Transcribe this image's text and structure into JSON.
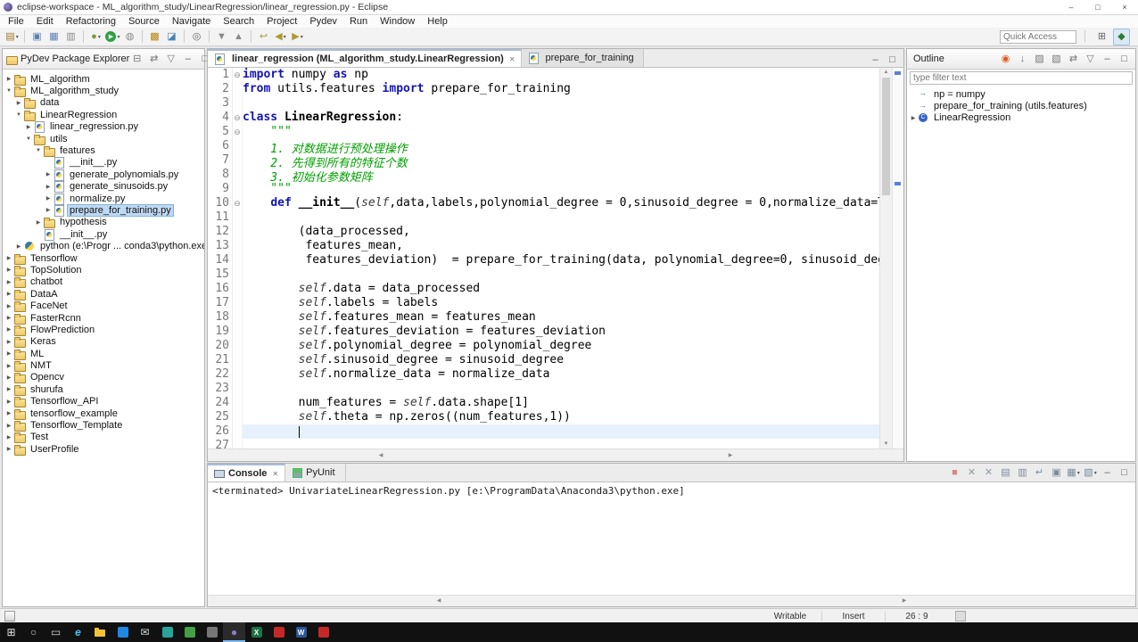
{
  "titlebar": {
    "title": "eclipse-workspace - ML_algorithm_study/LinearRegression/linear_regression.py - Eclipse",
    "controls": {
      "minimize": "–",
      "maximize": "□",
      "close": "×"
    }
  },
  "menubar": {
    "items": [
      "File",
      "Edit",
      "Refactoring",
      "Source",
      "Navigate",
      "Search",
      "Project",
      "Pydev",
      "Run",
      "Window",
      "Help"
    ]
  },
  "toolbar": {
    "quick_access_placeholder": "Quick Access",
    "items": [
      {
        "name": "new-wizard-button",
        "glyph": "▤",
        "color": "#a07828",
        "caret": true
      },
      "|",
      {
        "name": "save-button",
        "glyph": "▣",
        "color": "#5b7fb4"
      },
      {
        "name": "save-all-button",
        "glyph": "▦",
        "color": "#5b7fb4"
      },
      {
        "name": "print-button",
        "glyph": "▥",
        "color": "#888888"
      },
      "|",
      {
        "name": "debug-button",
        "glyph": "●",
        "color": "#7a9b3f",
        "caret": true
      },
      {
        "name": "run-button",
        "glyph": "▶",
        "color": "#2f9e44",
        "circle": true,
        "caret": true
      },
      {
        "name": "coverage-button",
        "glyph": "◍",
        "color": "#888888"
      },
      "|",
      {
        "name": "new-pydev-package-button",
        "glyph": "▩",
        "color": "#b8860b"
      },
      {
        "name": "new-pydev-module-button",
        "glyph": "◪",
        "color": "#4682b4"
      },
      "|",
      {
        "name": "search-button",
        "glyph": "◎",
        "color": "#666666"
      },
      "|",
      {
        "name": "next-annotation-button",
        "glyph": "▼",
        "color": "#888888"
      },
      {
        "name": "previous-annotation-button",
        "glyph": "▲",
        "color": "#888888"
      },
      "|",
      {
        "name": "last-edit-location-button",
        "glyph": "↩",
        "color": "#b09a30"
      },
      {
        "name": "back-button",
        "glyph": "◀",
        "color": "#b09a30",
        "caret": true
      },
      {
        "name": "forward-button",
        "glyph": "▶",
        "color": "#b09a30",
        "caret": true
      }
    ],
    "perspective_icons": [
      {
        "name": "open-perspective-button",
        "glyph": "⊞",
        "color": "#666666"
      },
      {
        "name": "pydev-perspective-button",
        "glyph": "◆",
        "color": "#2e7d32",
        "active": true
      }
    ]
  },
  "explorer": {
    "title": "PyDev Package Explorer",
    "header_icons": [
      {
        "name": "collapse-all-button",
        "glyph": "⊟",
        "color": "#777777"
      },
      {
        "name": "link-with-editor-button",
        "glyph": "⇄",
        "color": "#777777"
      },
      {
        "name": "view-menu-button",
        "glyph": "▽",
        "color": "#777777"
      },
      {
        "name": "minimize-view-button",
        "glyph": "–",
        "color": "#555555"
      },
      {
        "name": "maximize-view-button",
        "glyph": "□",
        "color": "#555555"
      }
    ],
    "items": [
      {
        "depth": 0,
        "arrow": ">",
        "icon": "project",
        "label": "ML_algorithm"
      },
      {
        "depth": 0,
        "arrow": "v",
        "icon": "project",
        "label": "ML_algorithm_study"
      },
      {
        "depth": 1,
        "arrow": ">",
        "icon": "folder",
        "label": "data"
      },
      {
        "depth": 1,
        "arrow": "v",
        "icon": "folder",
        "label": "LinearRegression"
      },
      {
        "depth": 2,
        "arrow": ">",
        "icon": "pyfile",
        "label": "linear_regression.py"
      },
      {
        "depth": 2,
        "arrow": "v",
        "icon": "package",
        "label": "utils"
      },
      {
        "depth": 3,
        "arrow": "v",
        "icon": "package",
        "label": "features"
      },
      {
        "depth": 4,
        "arrow": "",
        "icon": "pyfile",
        "label": "__init__.py"
      },
      {
        "depth": 4,
        "arrow": ">",
        "icon": "pyfile",
        "label": "generate_polynomials.py"
      },
      {
        "depth": 4,
        "arrow": ">",
        "icon": "pyfile",
        "label": "generate_sinusoids.py"
      },
      {
        "depth": 4,
        "arrow": ">",
        "icon": "pyfile",
        "label": "normalize.py"
      },
      {
        "depth": 4,
        "arrow": ">",
        "icon": "pyfile",
        "label": "prepare_for_training.py",
        "selected": true
      },
      {
        "depth": 3,
        "arrow": ">",
        "icon": "package",
        "label": "hypothesis"
      },
      {
        "depth": 3,
        "arrow": "",
        "icon": "pyfile",
        "label": "__init__.py"
      },
      {
        "depth": 1,
        "arrow": ">",
        "icon": "python",
        "label": "python (e:\\Progr ... conda3\\python.exe)"
      },
      {
        "depth": 0,
        "arrow": ">",
        "icon": "project",
        "label": "Tensorflow"
      },
      {
        "depth": 0,
        "arrow": ">",
        "icon": "project",
        "label": "TopSolution"
      },
      {
        "depth": 0,
        "arrow": ">",
        "icon": "project",
        "label": "chatbot"
      },
      {
        "depth": 0,
        "arrow": ">",
        "icon": "project",
        "label": "DataA"
      },
      {
        "depth": 0,
        "arrow": ">",
        "icon": "project",
        "label": "FaceNet"
      },
      {
        "depth": 0,
        "arrow": ">",
        "icon": "project",
        "label": "FasterRcnn"
      },
      {
        "depth": 0,
        "arrow": ">",
        "icon": "project",
        "label": "FlowPrediction"
      },
      {
        "depth": 0,
        "arrow": ">",
        "icon": "project",
        "label": "Keras"
      },
      {
        "depth": 0,
        "arrow": ">",
        "icon": "project",
        "label": "ML"
      },
      {
        "depth": 0,
        "arrow": ">",
        "icon": "project",
        "label": "NMT"
      },
      {
        "depth": 0,
        "arrow": ">",
        "icon": "project",
        "label": "Opencv"
      },
      {
        "depth": 0,
        "arrow": ">",
        "icon": "project",
        "label": "shurufa"
      },
      {
        "depth": 0,
        "arrow": ">",
        "icon": "project",
        "label": "Tensorflow_API"
      },
      {
        "depth": 0,
        "arrow": ">",
        "icon": "project",
        "label": "tensorflow_example"
      },
      {
        "depth": 0,
        "arrow": ">",
        "icon": "project",
        "label": "Tensorflow_Template"
      },
      {
        "depth": 0,
        "arrow": ">",
        "icon": "project",
        "label": "Test"
      },
      {
        "depth": 0,
        "arrow": ">",
        "icon": "project",
        "label": "UserProfile"
      }
    ]
  },
  "editor": {
    "tabs": [
      {
        "label": "linear_regression (ML_algorithm_study.LinearRegression)",
        "active": true
      },
      {
        "label": "prepare_for_training",
        "active": false
      }
    ],
    "tab_area_icons": [
      {
        "name": "minimize-editor-button",
        "glyph": "–",
        "color": "#555555"
      },
      {
        "name": "maximize-editor-button",
        "glyph": "□",
        "color": "#555555"
      }
    ],
    "folds": [
      1,
      4,
      5,
      10
    ],
    "current_line": 26,
    "cursor_col": 9,
    "lines": [
      [
        [
          "k",
          "import"
        ],
        [
          "t",
          " numpy "
        ],
        [
          "k",
          "as"
        ],
        [
          "t",
          " np"
        ]
      ],
      [
        [
          "k",
          "from"
        ],
        [
          "t",
          " utils.features "
        ],
        [
          "k",
          "import"
        ],
        [
          "t",
          " prepare_for_training"
        ]
      ],
      [],
      [
        [
          "k",
          "class"
        ],
        [
          "t",
          " "
        ],
        [
          "d",
          "LinearRegression"
        ],
        [
          "t",
          ":"
        ]
      ],
      [
        [
          "c",
          "    \"\"\""
        ]
      ],
      [
        [
          "c",
          "    1. 对数据进行预处理操作"
        ]
      ],
      [
        [
          "c",
          "    2. 先得到所有的特征个数"
        ]
      ],
      [
        [
          "c",
          "    3. 初始化参数矩阵"
        ]
      ],
      [
        [
          "c",
          "    \"\"\""
        ]
      ],
      [
        [
          "t",
          "    "
        ],
        [
          "k",
          "def"
        ],
        [
          "t",
          " "
        ],
        [
          "d",
          "__init__"
        ],
        [
          "t",
          "("
        ],
        [
          "s",
          "self"
        ],
        [
          "t",
          ",data,labels,polynomial_degree = 0,sinusoid_degree = 0,normalize_data=T"
        ]
      ],
      [],
      [
        [
          "t",
          "        (data_processed,"
        ]
      ],
      [
        [
          "t",
          "         features_mean,"
        ]
      ],
      [
        [
          "t",
          "         features_deviation)  = prepare_for_training(data, polynomial_degree=0, sinusoid_deg"
        ]
      ],
      [],
      [
        [
          "t",
          "        "
        ],
        [
          "s",
          "self"
        ],
        [
          "t",
          ".data = data_processed"
        ]
      ],
      [
        [
          "t",
          "        "
        ],
        [
          "s",
          "self"
        ],
        [
          "t",
          ".labels = labels"
        ]
      ],
      [
        [
          "t",
          "        "
        ],
        [
          "s",
          "self"
        ],
        [
          "t",
          ".features_mean = features_mean"
        ]
      ],
      [
        [
          "t",
          "        "
        ],
        [
          "s",
          "self"
        ],
        [
          "t",
          ".features_deviation = features_deviation"
        ]
      ],
      [
        [
          "t",
          "        "
        ],
        [
          "s",
          "self"
        ],
        [
          "t",
          ".polynomial_degree = polynomial_degree"
        ]
      ],
      [
        [
          "t",
          "        "
        ],
        [
          "s",
          "self"
        ],
        [
          "t",
          ".sinusoid_degree = sinusoid_degree"
        ]
      ],
      [
        [
          "t",
          "        "
        ],
        [
          "s",
          "self"
        ],
        [
          "t",
          ".normalize_data = normalize_data"
        ]
      ],
      [],
      [
        [
          "t",
          "        num_features = "
        ],
        [
          "s",
          "self"
        ],
        [
          "t",
          ".data.shape[1]"
        ]
      ],
      [
        [
          "t",
          "        "
        ],
        [
          "s",
          "self"
        ],
        [
          "t",
          ".theta = np.zeros((num_features,1))"
        ]
      ],
      [],
      []
    ]
  },
  "outline": {
    "title": "Outline",
    "filter_placeholder": "type filter text",
    "header_icons": [
      {
        "name": "pydev-logo-icon",
        "glyph": "◉",
        "color": "#e25822"
      },
      {
        "name": "sort-button",
        "glyph": "↓",
        "color": "#777777"
      },
      {
        "name": "hide-imports-button",
        "glyph": "▨",
        "color": "#777777"
      },
      {
        "name": "hide-comments-button",
        "glyph": "▧",
        "color": "#777777"
      },
      {
        "name": "link-with-editor-button",
        "glyph": "⇄",
        "color": "#777777"
      },
      {
        "name": "view-menu-button",
        "glyph": "▽",
        "color": "#777777"
      },
      {
        "name": "minimize-view-button",
        "glyph": "–",
        "color": "#555555"
      },
      {
        "name": "maximize-view-button",
        "glyph": "□",
        "color": "#555555"
      }
    ],
    "items": [
      {
        "icon": "import",
        "label": "np = numpy"
      },
      {
        "icon": "import",
        "label": "prepare_for_training (utils.features)"
      },
      {
        "icon": "class",
        "arrow": ">",
        "label": "LinearRegression"
      }
    ]
  },
  "console": {
    "tabs": [
      {
        "icon": "console",
        "label": "Console",
        "active": true
      },
      {
        "icon": "pyunit",
        "label": "PyUnit",
        "active": false
      }
    ],
    "toolbar_icons": [
      {
        "name": "terminate-button",
        "glyph": "■",
        "color": "#d98880"
      },
      {
        "name": "remove-launch-button",
        "glyph": "✕",
        "color": "#8a9aaa"
      },
      {
        "name": "remove-all-launches-button",
        "glyph": "✕",
        "color": "#8a9aaa"
      },
      {
        "name": "clear-console-button",
        "glyph": "▤",
        "color": "#7a8a9a"
      },
      {
        "name": "scroll-lock-button",
        "glyph": "▥",
        "color": "#7a8a9a"
      },
      {
        "name": "word-wrap-button",
        "glyph": "↵",
        "color": "#7a8a9a"
      },
      {
        "name": "pin-console-button",
        "glyph": "▣",
        "color": "#7a8a9a"
      },
      {
        "name": "display-selected-console-button",
        "glyph": "▦",
        "color": "#7a8a9a",
        "caret": true
      },
      {
        "name": "open-console-button",
        "glyph": "▧",
        "color": "#7a8a9a",
        "caret": true
      },
      {
        "name": "minimize-view-button",
        "glyph": "–",
        "color": "#555555"
      },
      {
        "name": "maximize-view-button",
        "glyph": "□",
        "color": "#555555"
      }
    ],
    "message": "<terminated> UnivariateLinearRegression.py [e:\\ProgramData\\Anaconda3\\python.exe]"
  },
  "statusbar": {
    "writable": "Writable",
    "insert_mode": "Insert",
    "cursor_position": "26 : 9"
  },
  "taskbar": {
    "items": [
      {
        "name": "start-button",
        "kind": "glyph",
        "glyph": "⊞",
        "color": "#e6e6e6"
      },
      {
        "name": "search-button",
        "kind": "glyph",
        "glyph": "○",
        "color": "#d0d0d0"
      },
      {
        "name": "task-view-button",
        "kind": "glyph",
        "glyph": "▭",
        "color": "#d0d0d0"
      },
      {
        "name": "edge-icon",
        "kind": "glyph",
        "glyph": "e",
        "color": "#4fc3f7",
        "bold": true
      },
      {
        "name": "file-explorer-icon",
        "kind": "folder"
      },
      {
        "name": "app-icon-blue",
        "kind": "square",
        "color": "#1e88e5"
      },
      {
        "name": "mail-icon",
        "kind": "glyph",
        "glyph": "✉",
        "color": "#cfd8dc"
      },
      {
        "name": "app-icon-teal",
        "kind": "square",
        "color": "#26a69a"
      },
      {
        "name": "app-icon-green",
        "kind": "square",
        "color": "#43a047"
      },
      {
        "name": "app-icon-gray",
        "kind": "square",
        "color": "#757575"
      },
      {
        "name": "eclipse-icon",
        "kind": "glyph",
        "glyph": "●",
        "color": "#8e7cc3",
        "active": true
      },
      {
        "name": "excel-icon",
        "kind": "square",
        "color": "#1e7145",
        "letter": "X"
      },
      {
        "name": "pdf-icon",
        "kind": "square",
        "color": "#c62828"
      },
      {
        "name": "word-icon",
        "kind": "square",
        "color": "#2b579a",
        "letter": "W"
      },
      {
        "name": "pdf-icon-2",
        "kind": "square",
        "color": "#c62828"
      }
    ]
  }
}
